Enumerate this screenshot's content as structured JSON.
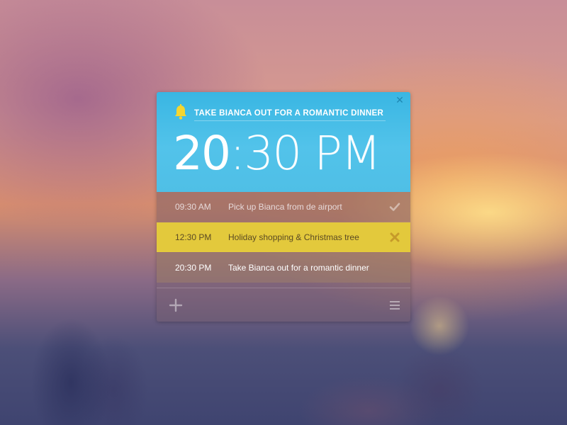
{
  "alarm": {
    "title": "TAKE BIANCA OUT FOR A ROMANTIC DINNER",
    "hour": "20",
    "minute_and_period": ":30 PM"
  },
  "icons": {
    "bell": "bell-icon",
    "close": "close-icon",
    "check": "check-icon",
    "delete": "x-icon",
    "add": "plus-icon",
    "menu": "menu-icon"
  },
  "reminders": [
    {
      "time": "09:30 AM",
      "text": "Pick up Bianca from de airport",
      "state": "done"
    },
    {
      "time": "12:30 PM",
      "text": "Holiday shopping & Christmas tree",
      "state": "selected"
    },
    {
      "time": "20:30 PM",
      "text": "Take Bianca out for a romantic dinner",
      "state": "active"
    }
  ],
  "colors": {
    "header": "#4fbfe6",
    "selected_row": "#e3c93c",
    "bell": "#f5d630",
    "x_mark": "#c69a2a"
  }
}
